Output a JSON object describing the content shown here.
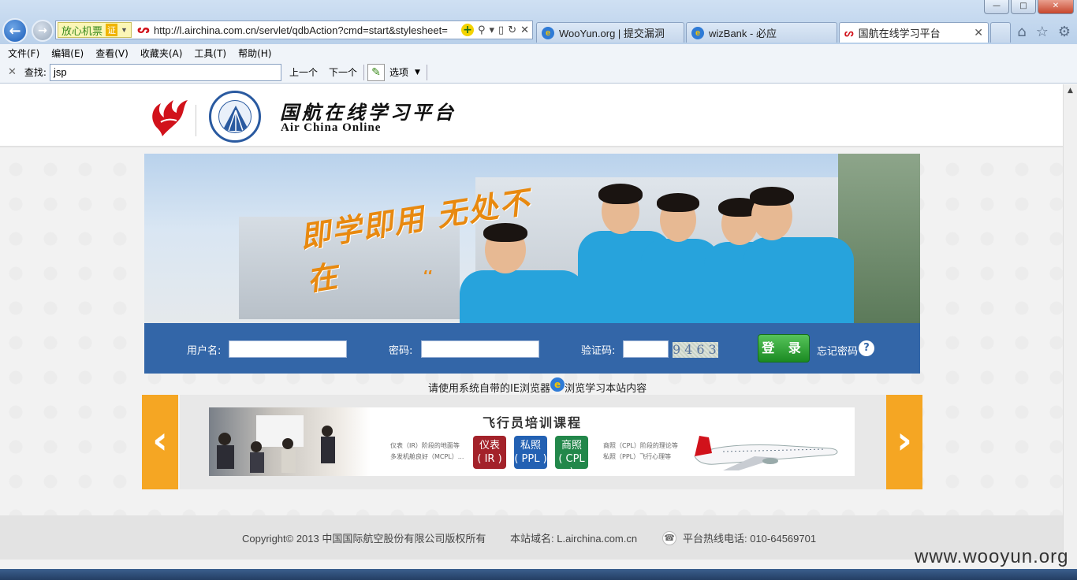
{
  "browser": {
    "secure_badge": "放心机票",
    "secure_cert": "证",
    "url": "http://l.airchina.com.cn/servlet/qdbAction?cmd=start&stylesheet=",
    "tabs": [
      {
        "label": "WooYun.org | 提交漏洞",
        "icon": "ie-icon"
      },
      {
        "label": "wizBank - 必应",
        "icon": "ie-icon"
      },
      {
        "label": "国航在线学习平台",
        "icon": "airchina-icon",
        "active": true
      }
    ],
    "menu": [
      "文件(F)",
      "编辑(E)",
      "查看(V)",
      "收藏夹(A)",
      "工具(T)",
      "帮助(H)"
    ],
    "find": {
      "label": "查找:",
      "value": "jsp",
      "prev": "上一个",
      "next": "下一个",
      "options": "选项"
    }
  },
  "site": {
    "title_cn": "国航在线学习平台",
    "title_en": "Air China Online",
    "slogan": "即学即用 无处不在"
  },
  "login": {
    "username_label": "用户名:",
    "password_label": "密码:",
    "captcha_label": "验证码:",
    "captcha_text": "9463",
    "login_button": "登 录",
    "forgot_password": "忘记密码",
    "help": "?"
  },
  "browser_note": {
    "before": "请使用系统自带的IE浏览器",
    "after": "浏览学习本站内容"
  },
  "carousel": {
    "prev_arrow": "‹",
    "next_arrow": "›",
    "slide_title": "飞行员培训课程",
    "desc_left": [
      "仪表（IR）阶段的地面等",
      "多发机舱良好（MCPL）..."
    ],
    "desc_right": [
      "商照（CPL）阶段的理论等",
      "私照（PPL）飞行心理等"
    ],
    "badges": [
      {
        "line1": "仪表",
        "line2": "( IR )"
      },
      {
        "line1": "私照",
        "line2": "( PPL )"
      },
      {
        "line1": "商照",
        "line2": "( CPL )"
      }
    ]
  },
  "footer": {
    "copyright": "Copyright© 2013 中国国际航空股份有限公司版权所有",
    "domain": "本站域名: L.airchina.com.cn",
    "hotline": "平台热线电话: 010-64569701"
  },
  "watermark": "www.wooyun.org",
  "colors": {
    "login_bar": "#3366a8",
    "login_button": "#1b8a22",
    "arrow": "#f5a623",
    "brand_red": "#d1121b"
  }
}
